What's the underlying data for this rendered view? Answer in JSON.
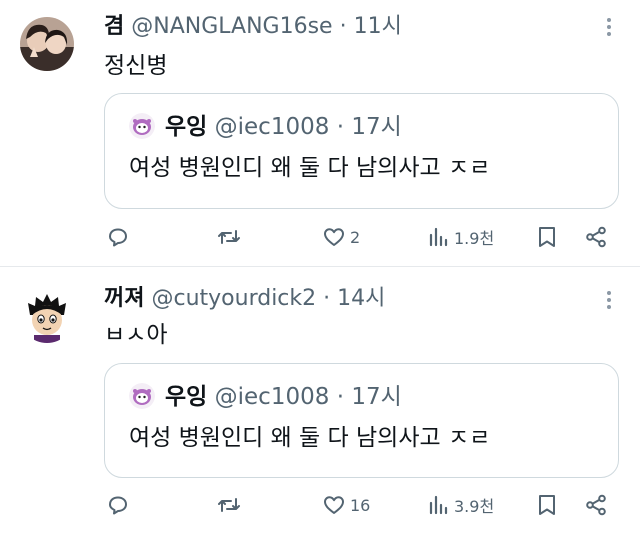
{
  "tweets": [
    {
      "name": "겸",
      "handle": "@NANGLANG16se",
      "dot": "·",
      "time": "11시",
      "text": "정신병",
      "quote": {
        "name": "우잉",
        "handle": "@iec1008",
        "dot": "·",
        "time": "17시",
        "text": "여성 병원인디 왜 둘 다 남의사고 ㅈㄹ"
      },
      "likes": "2",
      "views": "1.9천"
    },
    {
      "name": "꺼져",
      "handle": "@cutyourdick2",
      "dot": "·",
      "time": "14시",
      "text": "ㅂㅅ아",
      "quote": {
        "name": "우잉",
        "handle": "@iec1008",
        "dot": "·",
        "time": "17시",
        "text": "여성 병원인디 왜 둘 다 남의사고 ㅈㄹ"
      },
      "likes": "16",
      "views": "3.9천"
    }
  ],
  "icons": [
    "reply-icon",
    "retweet-icon",
    "heart-icon",
    "views-icon",
    "bookmark-icon",
    "share-icon",
    "more-icon"
  ],
  "colors": {
    "text": "#0f1419",
    "secondary": "#536471",
    "border": "#cfd9de",
    "divider": "#e6e9ec"
  }
}
